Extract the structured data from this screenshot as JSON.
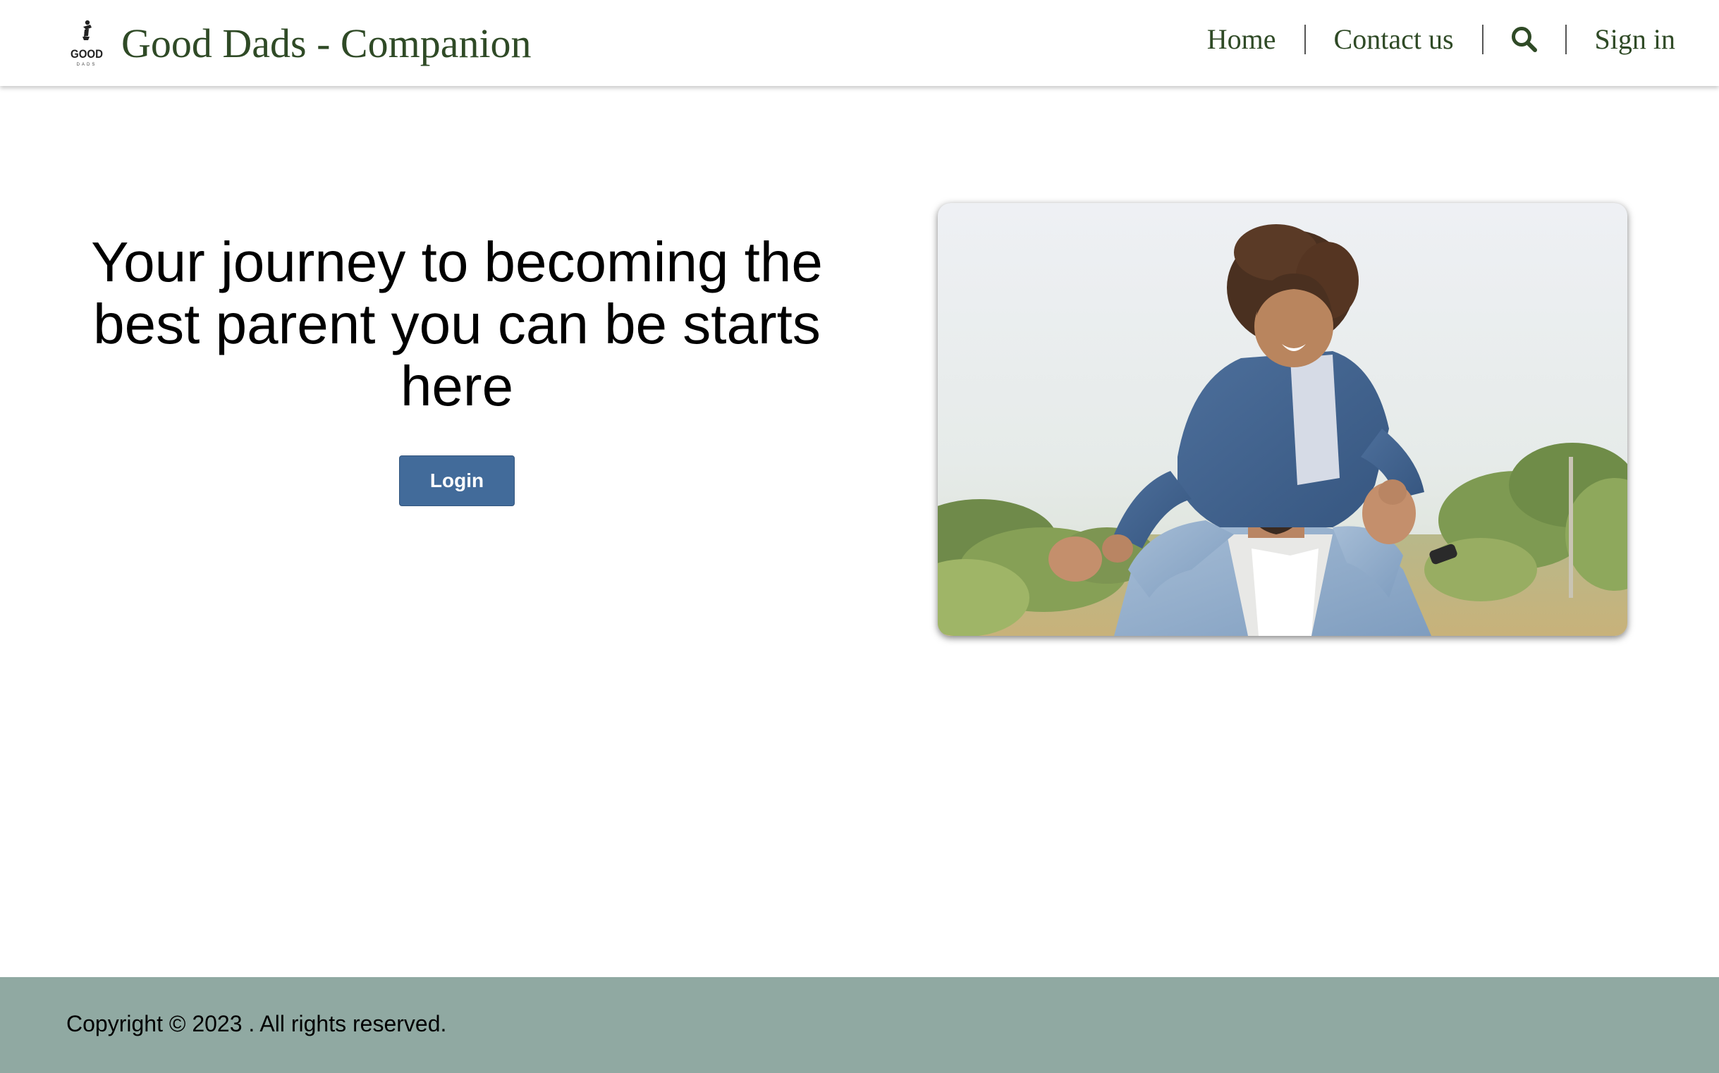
{
  "header": {
    "logo_icon": "good-dads-logo",
    "logo_text": "GOOD",
    "logo_subtext": "DADS",
    "title": "Good Dads - Companion",
    "nav": [
      {
        "label": "Home"
      },
      {
        "label": "Contact us"
      },
      {
        "icon": "search-icon"
      },
      {
        "label": "Sign in"
      }
    ]
  },
  "hero": {
    "heading": "Your journey to becoming the best parent you can be starts here",
    "login_label": "Login",
    "image": "photo-father-carrying-child-on-shoulders"
  },
  "footer": {
    "copyright": "Copyright © 2023 . All rights reserved."
  },
  "colors": {
    "brand_text": "#2f4a26",
    "login_button": "#426b9a",
    "footer_bg": "#90a9a2"
  }
}
